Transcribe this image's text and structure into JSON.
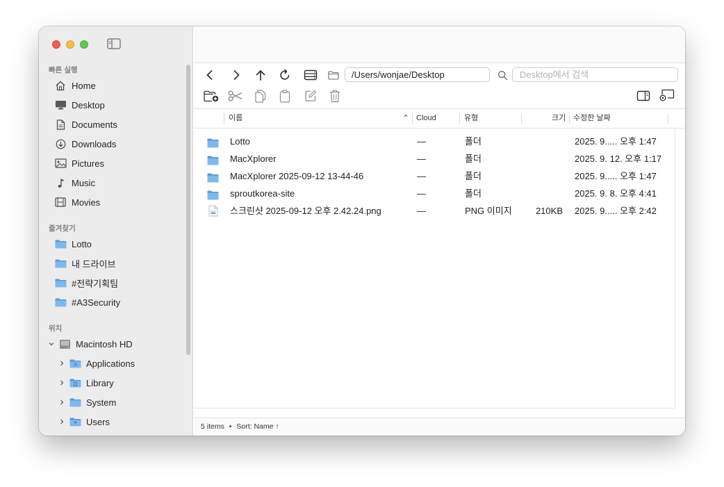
{
  "sidebar": {
    "sections": {
      "recent": "빠른 실행",
      "favorites": "즐겨찾기",
      "locations": "위치"
    },
    "recent_items": [
      {
        "label": "Home",
        "icon": "house-icon"
      },
      {
        "label": "Desktop",
        "icon": "monitor-icon"
      },
      {
        "label": "Documents",
        "icon": "document-icon"
      },
      {
        "label": "Downloads",
        "icon": "download-icon"
      },
      {
        "label": "Pictures",
        "icon": "photo-icon"
      },
      {
        "label": "Music",
        "icon": "music-note-icon"
      },
      {
        "label": "Movies",
        "icon": "film-icon"
      }
    ],
    "favorite_items": [
      {
        "label": "Lotto",
        "icon": "folder-icon"
      },
      {
        "label": "내 드라이브",
        "icon": "folder-icon"
      },
      {
        "label": "#전략기획팀",
        "icon": "folder-icon"
      },
      {
        "label": "#A3Security",
        "icon": "folder-icon"
      }
    ],
    "location_root": {
      "label": "Macintosh HD",
      "icon": "hard-drive-icon",
      "expanded": true
    },
    "location_children": [
      {
        "label": "Applications",
        "icon": "folder-icon"
      },
      {
        "label": "Library",
        "icon": "folder-icon"
      },
      {
        "label": "System",
        "icon": "folder-icon"
      },
      {
        "label": "Users",
        "icon": "folder-icon"
      }
    ]
  },
  "toolbar": {
    "path": "/Users/wonjae/Desktop",
    "search_placeholder": "Desktop에서 검색"
  },
  "columns": {
    "name": "이름",
    "cloud": "Cloud",
    "kind": "유형",
    "size": "크기",
    "modified": "수정한 날짜",
    "sort_indicator": "⌃"
  },
  "files": [
    {
      "name": "Lotto",
      "cloud": "—",
      "kind": "폴더",
      "size": "",
      "modified": "2025. 9..... 오후 1:47",
      "icon": "folder-icon"
    },
    {
      "name": "MacXplorer",
      "cloud": "—",
      "kind": "폴더",
      "size": "",
      "modified": "2025. 9. 12. 오후 1:17",
      "icon": "folder-icon"
    },
    {
      "name": "MacXplorer 2025-09-12 13-44-46",
      "cloud": "—",
      "kind": "폴더",
      "size": "",
      "modified": "2025. 9..... 오후 1:47",
      "icon": "folder-icon"
    },
    {
      "name": "sproutkorea-site",
      "cloud": "—",
      "kind": "폴더",
      "size": "",
      "modified": "2025. 9. 8. 오후 4:41",
      "icon": "folder-icon"
    },
    {
      "name": "스크린샷 2025-09-12 오후 2.42.24.png",
      "cloud": "—",
      "kind": "PNG 이미지",
      "size": "210KB",
      "modified": "2025. 9..... 오후 2:42",
      "icon": "image-file-icon"
    }
  ],
  "status": {
    "count": "5 items",
    "dot": "•",
    "sort": "Sort: Name ↑"
  },
  "colors": {
    "folder": "#7fb8ea",
    "folder_dark": "#5a9bd8"
  }
}
